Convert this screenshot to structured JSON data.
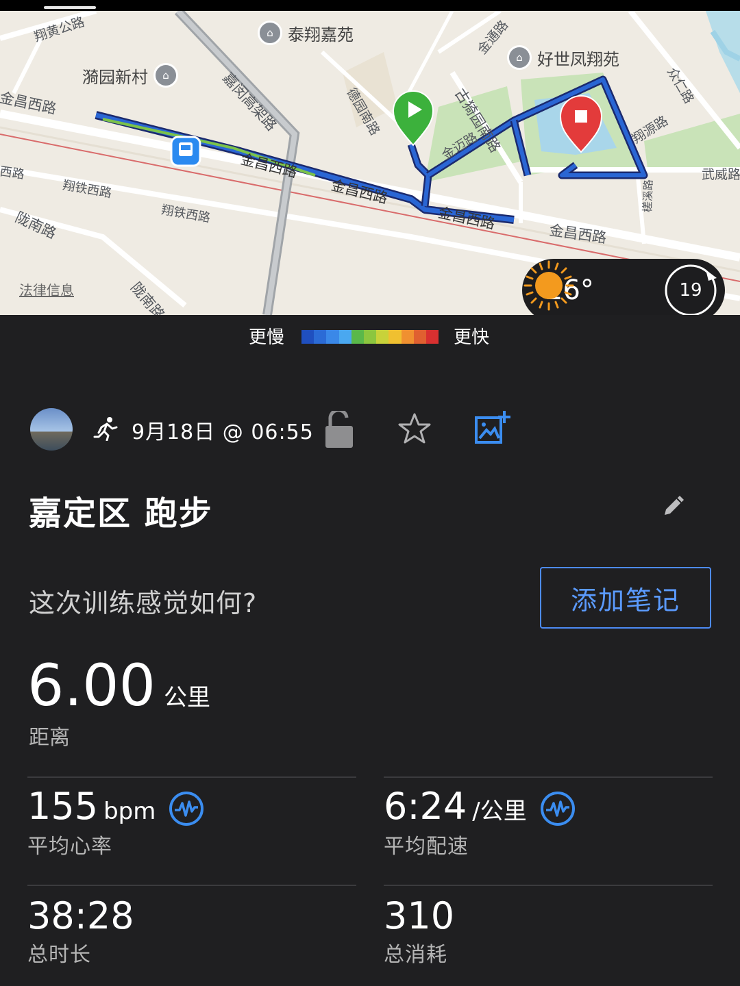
{
  "map": {
    "poi": [
      {
        "name": "泰翔嘉苑"
      },
      {
        "name": "好世凤翔苑"
      },
      {
        "name": "漪园新村"
      }
    ],
    "roads": [
      "翔黄公路",
      "嘉闵高架路",
      "金通路",
      "德园南路",
      "古猗园南路",
      "众仁路",
      "金昌西路",
      "金迈路",
      "翔源路",
      "武威路",
      "翔铁西路",
      "翔铁西路",
      "陇南路",
      "金昌西路",
      "金昌西路",
      "金昌西路",
      "槎溪路",
      "陇南路",
      "金昌西路",
      "西路"
    ],
    "legal": "法律信息"
  },
  "weather": {
    "temp": "26°",
    "speed": "19"
  },
  "legend": {
    "slow": "更慢",
    "fast": "更快",
    "colors": [
      "#1f4fbf",
      "#2b6bd6",
      "#3a88e8",
      "#4aa8f0",
      "#5ab84a",
      "#8cc63f",
      "#c8d23a",
      "#f0c030",
      "#f09030",
      "#e06030",
      "#d83030"
    ]
  },
  "activity": {
    "date": "9月18日 @ 06:55",
    "title": "嘉定区 跑步",
    "feel_prompt": "这次训练感觉如何?",
    "add_note": "添加笔记",
    "distance": {
      "value": "6.00",
      "unit": "公里",
      "label": "距离"
    },
    "heart_rate": {
      "value": "155",
      "unit": "bpm",
      "label": "平均心率"
    },
    "pace": {
      "value": "6:24",
      "unit": "/公里",
      "label": "平均配速"
    },
    "duration": {
      "value": "38:28",
      "label": "总时长"
    },
    "calories": {
      "value": "310",
      "label": "总消耗"
    }
  }
}
